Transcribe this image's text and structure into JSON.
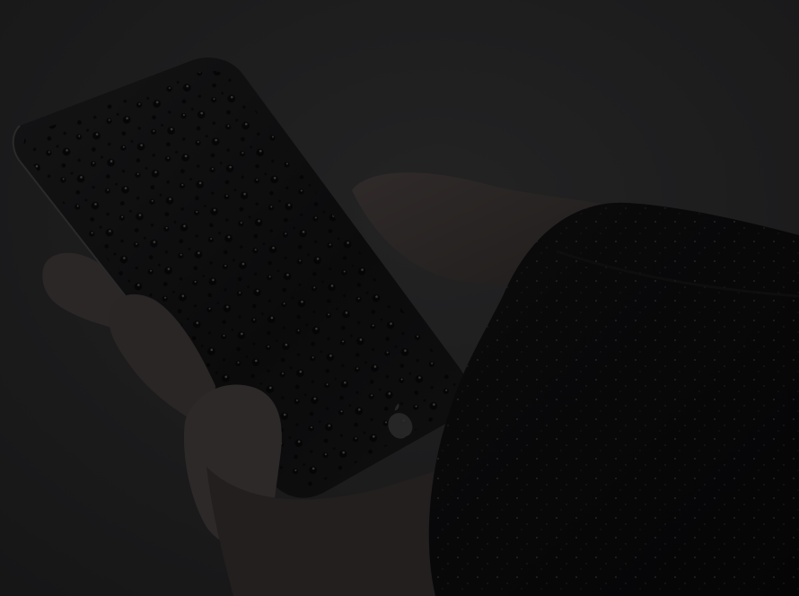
{
  "scene": {
    "subject": "hand-holding-wet-smartphone",
    "logo_icon": "apple-logo-icon",
    "colors": {
      "background": "#1b1b1c",
      "phone_body": "#0c0c0d",
      "sleeve": "#060607",
      "skin": "#2a2625",
      "droplet": "#060606",
      "droplet_highlight": "#3a3a3b"
    }
  }
}
